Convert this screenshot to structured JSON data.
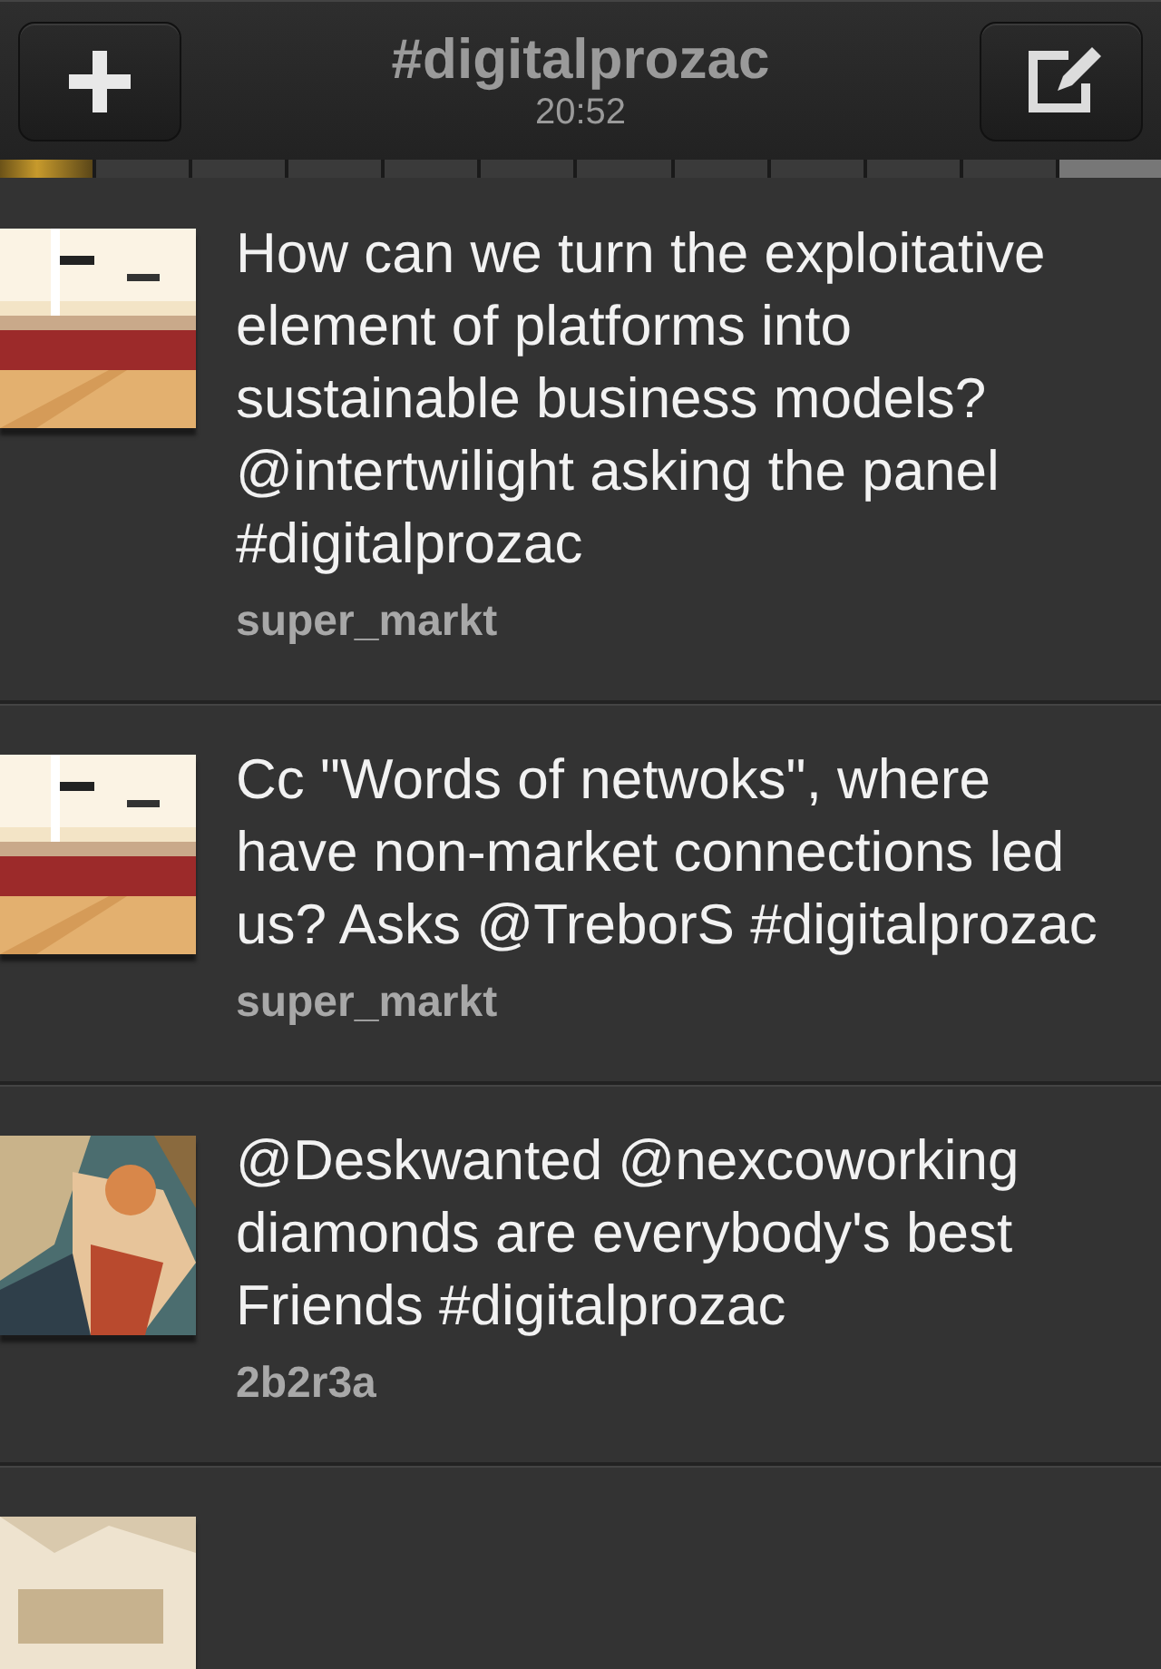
{
  "header": {
    "title": "#digitalprozac",
    "time": "20:52"
  },
  "segments": [
    {
      "kind": "new"
    },
    {
      "kind": "plain"
    },
    {
      "kind": "plain"
    },
    {
      "kind": "plain"
    },
    {
      "kind": "plain"
    },
    {
      "kind": "plain"
    },
    {
      "kind": "plain"
    },
    {
      "kind": "plain"
    },
    {
      "kind": "plain"
    },
    {
      "kind": "plain"
    },
    {
      "kind": "plain"
    },
    {
      "kind": "current"
    }
  ],
  "tweets": [
    {
      "avatar": {
        "kind": "picture"
      },
      "text": "How can we turn the exploitative element of platforms into sustainable business models? @intertwilight asking the panel #digitalprozac",
      "user": "super_markt"
    },
    {
      "avatar": {
        "kind": "picture"
      },
      "text": "Cc \"Words of netwoks\", where have non-market connections led us? Asks @TreborS #digitalprozac",
      "user": "super_markt"
    },
    {
      "avatar": {
        "kind": "picture"
      },
      "text": "@Deskwanted @nexcoworking diamonds are everybody's best Friends #digitalprozac",
      "user": "2b2r3a"
    },
    {
      "avatar": {
        "kind": "picture"
      }
    }
  ]
}
